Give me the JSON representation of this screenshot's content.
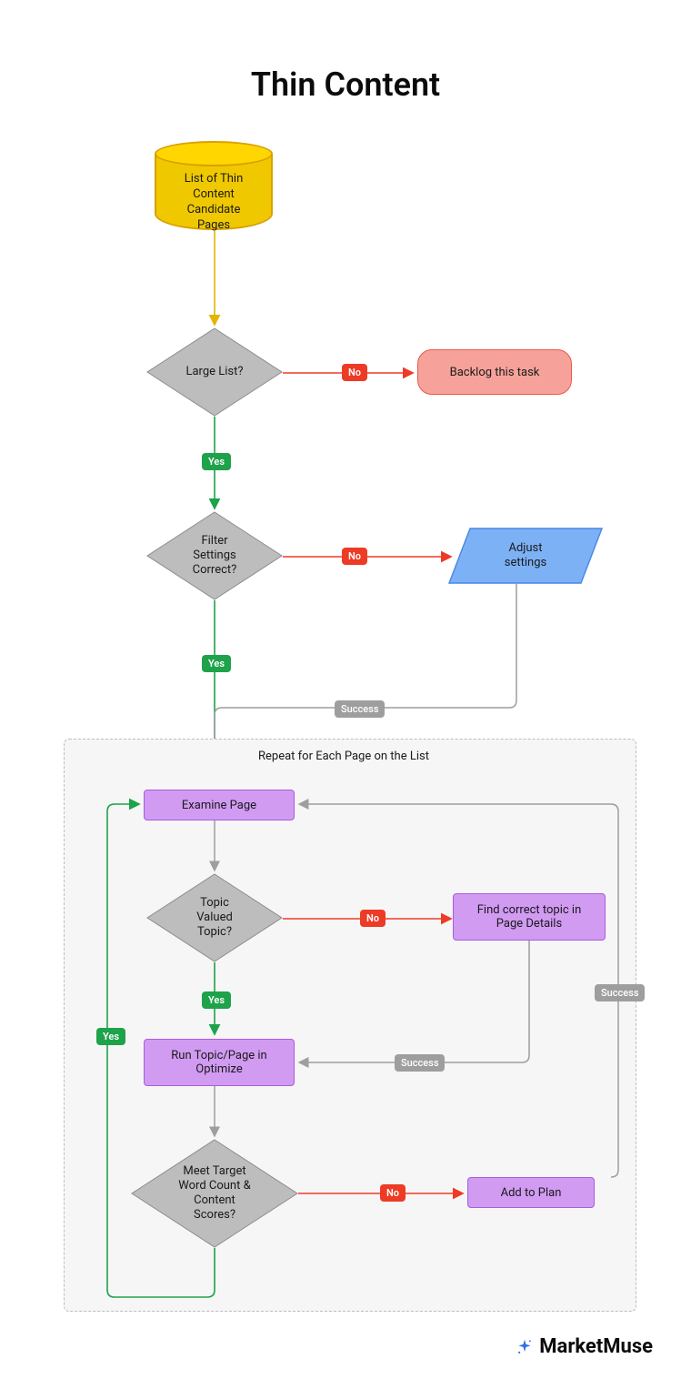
{
  "title": "Thin Content",
  "nodes": {
    "db": "List of Thin\nContent\nCandidate\nPages",
    "d_large": "Large List?",
    "t_backlog": "Backlog this task",
    "d_filter": "Filter\nSettings\nCorrect?",
    "p_adjust": "Adjust\nsettings",
    "loop_title": "Repeat for Each Page on the List",
    "pr_examine": "Examine Page",
    "d_topic": "Topic\nValued\nTopic?",
    "pr_findtopic": "Find correct topic in\nPage Details",
    "pr_optimize": "Run Topic/Page in\nOptimize",
    "d_meet": "Meet Target\nWord Count &\nContent\nScores?",
    "pr_addplan": "Add to Plan"
  },
  "labels": {
    "yes": "Yes",
    "no": "No",
    "success": "Success"
  },
  "brand": "MarketMuse",
  "colors": {
    "green": "#1ea24a",
    "red": "#ed3b26",
    "grey": "#9e9e9e",
    "yellow": "#e3b400",
    "purpleFill": "#d19bf2",
    "purpleStroke": "#aa5be0",
    "blueFill": "#7db1f6",
    "blueStroke": "#4a86e6",
    "diamondFill": "#bdbdbd",
    "diamondStroke": "#8c8c8c"
  }
}
